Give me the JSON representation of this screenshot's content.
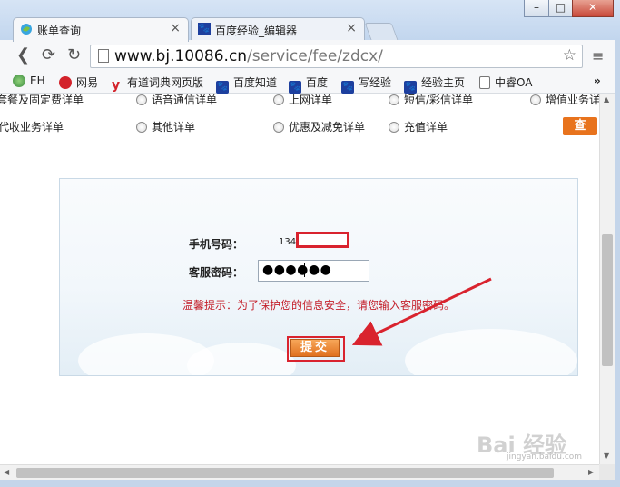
{
  "tabs": [
    {
      "title": "账单查询",
      "active": true,
      "close": "×"
    },
    {
      "title": "百度经验_编辑器",
      "active": false,
      "close": "×"
    }
  ],
  "window_controls": {
    "minimize": "–",
    "maximize": "□",
    "close": "✕"
  },
  "toolbar": {
    "url_host": "www.bj.10086.cn",
    "url_path": "/service/fee/zdcx/",
    "back": "❮",
    "forward": "⟳",
    "reload": "↻",
    "star": "☆",
    "menu": "≡"
  },
  "bookmarks": [
    {
      "label": "EH",
      "icon": "globe-icon"
    },
    {
      "label": "网易",
      "icon": "netease-icon"
    },
    {
      "label": "有道词典网页版",
      "icon": "youdao-icon"
    },
    {
      "label": "百度知道",
      "icon": "baidu-paw-icon"
    },
    {
      "label": "百度",
      "icon": "baidu-paw-icon"
    },
    {
      "label": "写经验",
      "icon": "baidu-paw-icon"
    },
    {
      "label": "经验主页",
      "icon": "baidu-paw-icon"
    },
    {
      "label": "中睿OA",
      "icon": "page-icon"
    },
    {
      "label": "»",
      "icon": "more-icon"
    }
  ],
  "options_row1": [
    "套餐及固定费详单",
    "语音通信详单",
    "上网详单",
    "短信/彩信详单",
    "增值业务详单"
  ],
  "options_row2": [
    "代收业务详单",
    "其他详单",
    "优惠及减免详单",
    "充值详单"
  ],
  "query_button": "查",
  "form": {
    "phone_label": "手机号码：",
    "phone_value": "134",
    "password_label": "客服密码：",
    "password_value": "●●●●●●",
    "hint": "温馨提示：为了保护您的信息安全，请您输入客服密码。",
    "submit_label": "提交"
  },
  "watermark": {
    "main": "Bai 经验",
    "sub": "jingyan.baidu.com"
  },
  "colors": {
    "accent_orange": "#e8731d",
    "highlight_red": "#d9232e",
    "hint_red": "#c4202b"
  }
}
